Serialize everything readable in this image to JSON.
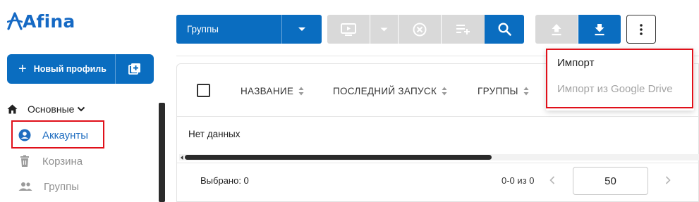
{
  "app": {
    "brand": "Afina",
    "brand_color": "#1569c4",
    "accent_color": "#0a6dc0",
    "highlight_color": "#e0101a"
  },
  "sidebar": {
    "new_profile_label": "Новый профиль",
    "new_profile_icon": "plus-icon",
    "extra_icon": "add-batch-icon",
    "main_section": {
      "label": "Основные",
      "icon": "home-icon",
      "chevron": "chevron-down-icon"
    },
    "items": [
      {
        "label": "Аккаунты",
        "icon": "account-circle-icon",
        "active": true
      },
      {
        "label": "Корзина",
        "icon": "trash-icon",
        "active": false
      },
      {
        "label": "Группы",
        "icon": "group-icon",
        "active": false
      }
    ]
  },
  "toolbar": {
    "groups_select": {
      "value": "Группы",
      "icon": "caret-down-icon"
    },
    "buttons": [
      {
        "name": "run",
        "icon": "play-window-icon",
        "disabled": true
      },
      {
        "name": "run-menu",
        "icon": "caret-down-icon",
        "disabled": true
      },
      {
        "name": "stop",
        "icon": "cancel-circle-icon",
        "disabled": true
      },
      {
        "name": "add-to-queue",
        "icon": "playlist-add-icon",
        "disabled": true
      },
      {
        "name": "search",
        "icon": "search-icon",
        "disabled": false
      },
      {
        "name": "upload",
        "icon": "upload-icon",
        "disabled": true
      },
      {
        "name": "download",
        "icon": "download-icon",
        "disabled": false
      },
      {
        "name": "more",
        "icon": "more-vert-icon",
        "disabled": false
      }
    ]
  },
  "table": {
    "columns": [
      {
        "label": "НАЗВАНИЕ"
      },
      {
        "label": "ПОСЛЕДНИЙ ЗАПУСК"
      },
      {
        "label": "ГРУППЫ"
      }
    ],
    "empty_text": "Нет данных"
  },
  "footer": {
    "selected_label": "Выбрано: 0",
    "page_info": "0-0 из 0",
    "page_size": "50"
  },
  "more_menu": {
    "items": [
      {
        "label": "Импорт",
        "disabled": false
      },
      {
        "label": "Импорт из Google Drive",
        "disabled": true
      }
    ]
  }
}
